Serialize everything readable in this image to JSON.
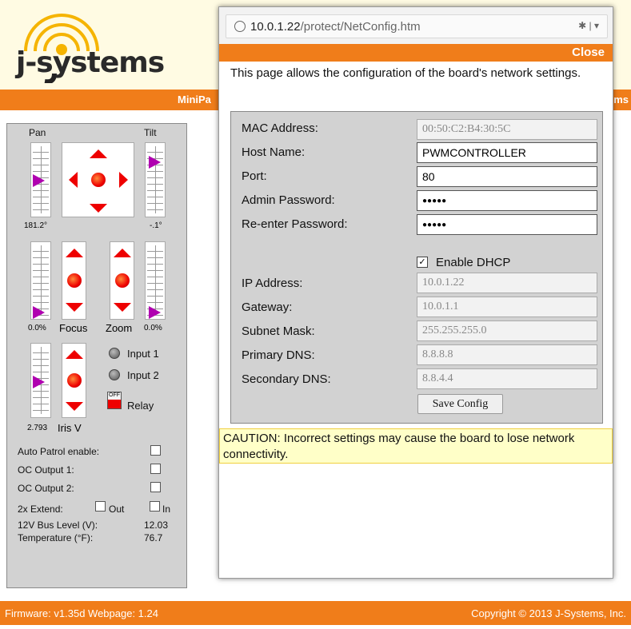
{
  "brand": {
    "logo_text": "j-systems"
  },
  "nav": {
    "minipage_label": "MiniPa",
    "right_label": "ems"
  },
  "controls": {
    "pan_label": "Pan",
    "tilt_label": "Tilt",
    "pan_value": "181.2°",
    "tilt_value": "-.1°",
    "focus_label": "Focus",
    "zoom_label": "Zoom",
    "focus_value": "0.0%",
    "zoom_value": "0.0%",
    "iris_label": "Iris V",
    "iris_value": "2.793",
    "input1_label": "Input 1",
    "input2_label": "Input 2",
    "relay_label": "Relay",
    "relay_switch_text": "OFF",
    "auto_patrol_label": "Auto Patrol enable:",
    "oc1_label": "OC Output 1:",
    "oc2_label": "OC Output 2:",
    "extend_label": "2x Extend:",
    "extend_out_label": "Out",
    "extend_in_label": "In",
    "bus_level_label": "12V Bus Level (V):",
    "bus_level_value": "12.03",
    "temperature_label": "Temperature (°F):",
    "temperature_value": "76.7"
  },
  "footer": {
    "left": "Firmware: v1.35d   Webpage: 1.24",
    "right": "Copyright © 2013 J-Systems, Inc."
  },
  "popup": {
    "url_host": "10.0.1.22",
    "url_path": "/protect/NetConfig.htm",
    "close_label": "Close",
    "intro": "This page allows the configuration of the board's network settings.",
    "mac_label": "MAC Address:",
    "mac_value": "00:50:C2:B4:30:5C",
    "host_label": "Host Name:",
    "host_value": "PWMCONTROLLER",
    "port_label": "Port:",
    "port_value": "80",
    "admin_pw_label": "Admin Password:",
    "admin_pw_value": "●●●●●",
    "reenter_pw_label": "Re-enter Password:",
    "reenter_pw_value": "●●●●●",
    "dhcp_label": "Enable DHCP",
    "dhcp_checked": true,
    "ip_label": "IP Address:",
    "ip_value": "10.0.1.22",
    "gateway_label": "Gateway:",
    "gateway_value": "10.0.1.1",
    "subnet_label": "Subnet Mask:",
    "subnet_value": "255.255.255.0",
    "dns1_label": "Primary DNS:",
    "dns1_value": "8.8.8.8",
    "dns2_label": "Secondary DNS:",
    "dns2_value": "8.8.4.4",
    "save_label": "Save Config",
    "caution": "CAUTION: Incorrect settings may cause the board to lose network connectivity."
  },
  "colors": {
    "accent": "#f07d1a",
    "panel": "#d2d2d2",
    "caution_bg": "#ffffc8"
  }
}
